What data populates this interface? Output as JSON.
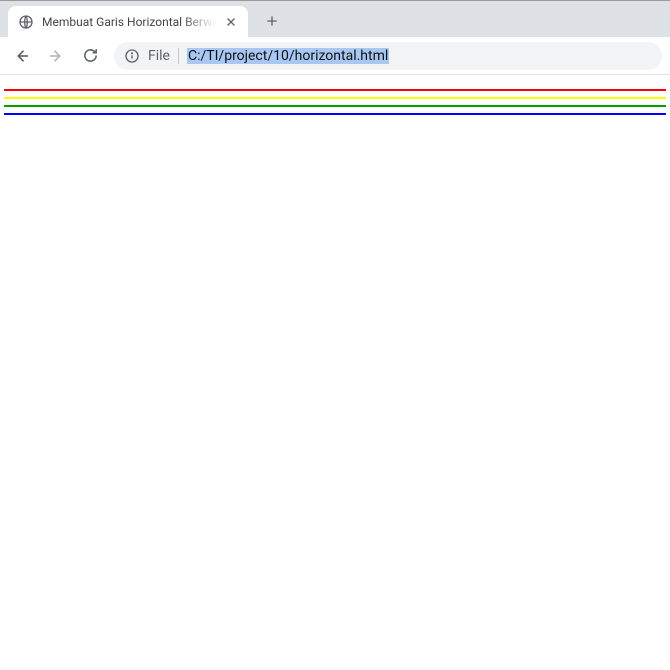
{
  "tab": {
    "title": "Membuat Garis Horizontal Berwarna"
  },
  "omnibox": {
    "scheme_label": "File",
    "url_path": "C:/TI/project/10/horizontal.html"
  },
  "content": {
    "lines": [
      {
        "color": "#ff0000"
      },
      {
        "color": "#ffff00"
      },
      {
        "color": "#00a000"
      },
      {
        "color": "#0000ff"
      }
    ]
  }
}
